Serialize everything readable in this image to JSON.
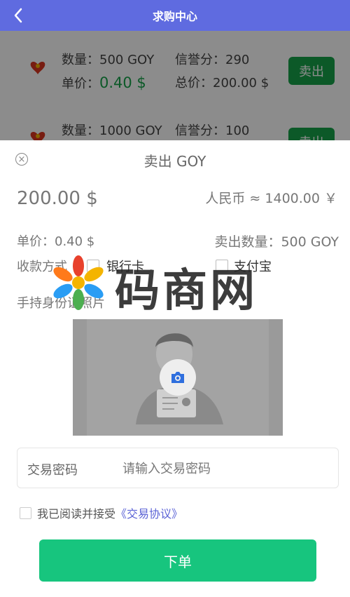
{
  "header": {
    "title": "求购中心"
  },
  "list": {
    "sell_label": "卖出",
    "cards": [
      {
        "qty": "数量：500 GOY",
        "credit": "信誉分：290",
        "unit_label": "单价：",
        "price": "0.40 $",
        "total": "总价：200.00 $"
      },
      {
        "qty": "数量：1000 GOY",
        "credit": "信誉分：100"
      }
    ]
  },
  "sheet": {
    "title": "卖出 GOY",
    "amount": "200.00 $",
    "rmb": "人民币 ≈ 1400.00 ￥",
    "unit_price": "单价：0.40 $",
    "sell_qty": "卖出数量：500 GOY",
    "pay_label": "收款方式",
    "pay_options": [
      "银行卡",
      "支付宝"
    ],
    "id_label": "手持身份证照片",
    "password": {
      "label": "交易密码",
      "placeholder": "请输入交易密码",
      "value": ""
    },
    "agree_text": "我已阅读并接受",
    "agree_link": "《交易协议》",
    "submit_label": "下单"
  },
  "watermark": {
    "text": "码商网"
  },
  "colors": {
    "header": "#5f6be0",
    "accent_green": "#16a34a",
    "submit_green": "#17c57e",
    "link_blue": "#5b63d6"
  }
}
